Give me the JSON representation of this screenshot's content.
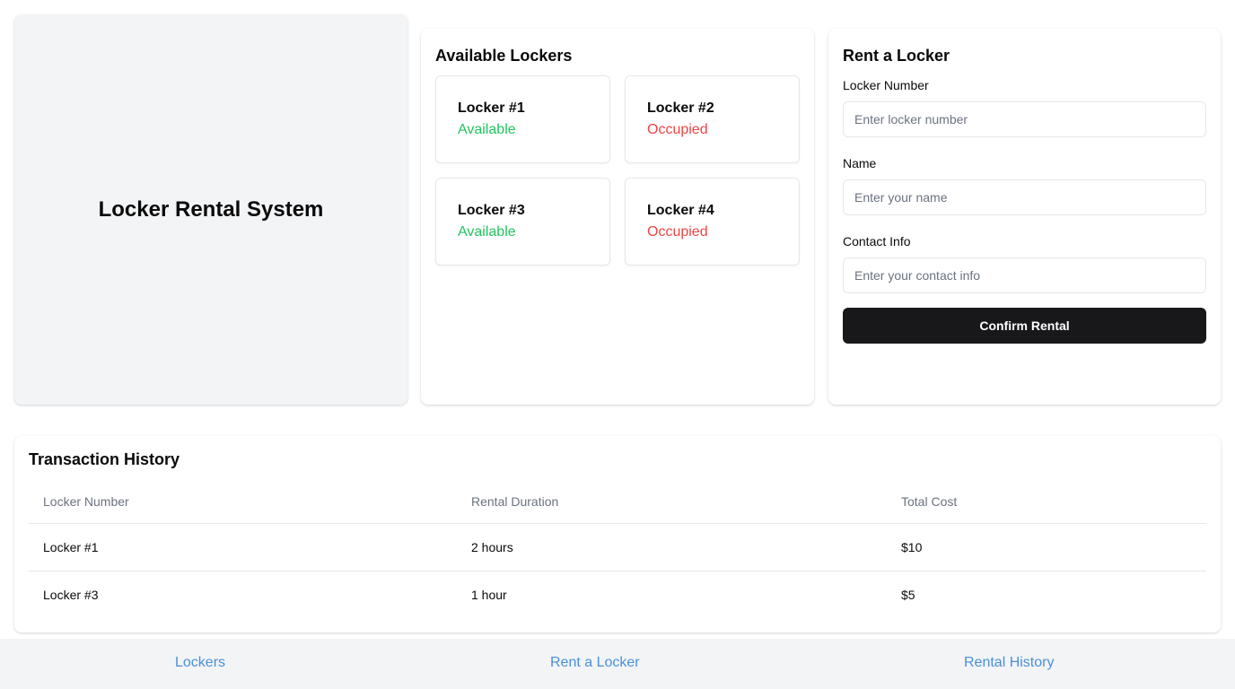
{
  "hero": {
    "title": "Locker Rental System"
  },
  "lockers": {
    "title": "Available Lockers",
    "items": [
      {
        "name": "Locker #1",
        "status": "Available"
      },
      {
        "name": "Locker #2",
        "status": "Occupied"
      },
      {
        "name": "Locker #3",
        "status": "Available"
      },
      {
        "name": "Locker #4",
        "status": "Occupied"
      }
    ]
  },
  "rent": {
    "title": "Rent a Locker",
    "locker_number_label": "Locker Number",
    "locker_number_placeholder": "Enter locker number",
    "name_label": "Name",
    "name_placeholder": "Enter your name",
    "contact_label": "Contact Info",
    "contact_placeholder": "Enter your contact info",
    "confirm_label": "Confirm Rental"
  },
  "history": {
    "title": "Transaction History",
    "columns": [
      "Locker Number",
      "Rental Duration",
      "Total Cost"
    ],
    "rows": [
      [
        "Locker #1",
        "2 hours",
        "$10"
      ],
      [
        "Locker #3",
        "1 hour",
        "$5"
      ]
    ]
  },
  "footer": {
    "links": [
      "Lockers",
      "Rent a Locker",
      "Rental History"
    ]
  },
  "colors": {
    "available": "#22c55e",
    "occupied": "#ef4444",
    "link": "#4a90d9",
    "button": "#18181b"
  }
}
